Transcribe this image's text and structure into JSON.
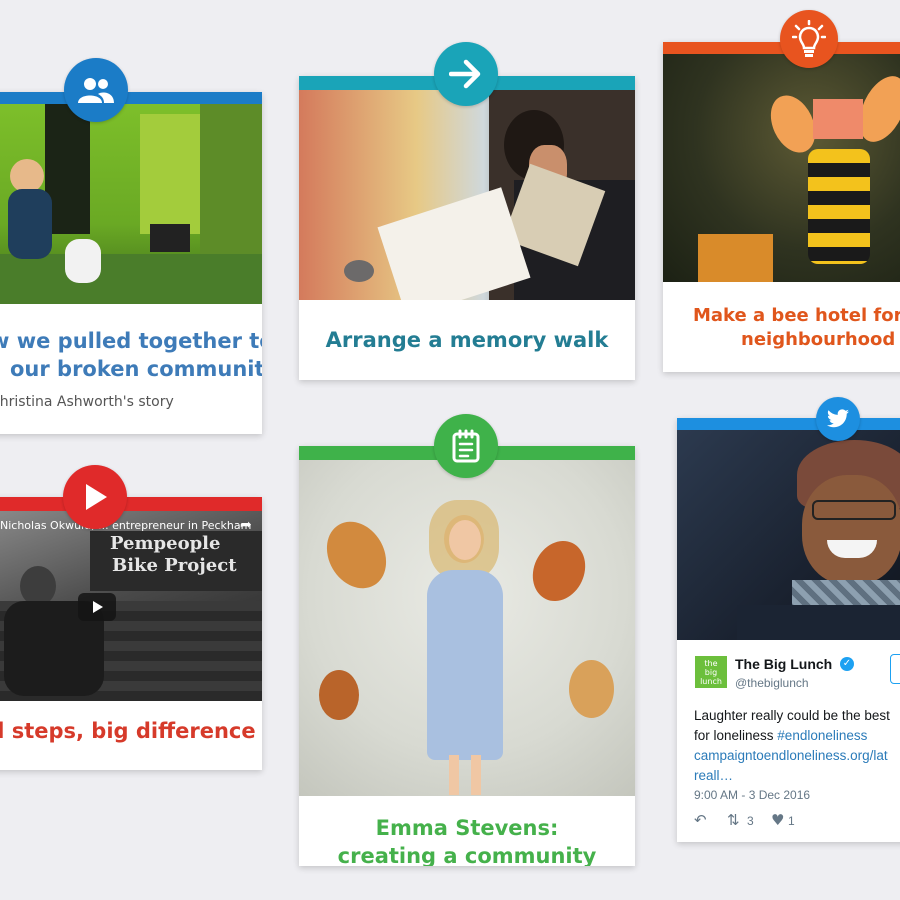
{
  "colors": {
    "blue": "#1b7cc7",
    "blue_text": "#3e7bb8",
    "teal": "#1aa4b8",
    "teal_text": "#237d93",
    "orange": "#e8541f",
    "orange_text": "#e0561c",
    "red": "#e02a2a",
    "red_text": "#d63a2a",
    "green": "#3fb24a",
    "green_text": "#45b14b",
    "twitter": "#1d8fe0"
  },
  "cards": {
    "community": {
      "icon": "people-icon",
      "title_line1": "w we pulled together to",
      "title_line2": "our broken community",
      "byline": "Christina Ashworth's story"
    },
    "memory_walk": {
      "icon": "arrow-right-icon",
      "title": "Arrange a memory walk"
    },
    "bee_hotel": {
      "icon": "lightbulb-icon",
      "title_line1": "Make a bee hotel for y",
      "title_line2": "neighbourhood"
    },
    "video": {
      "icon": "play-icon",
      "video_title": "Nicholas Okwulu, ... entrepreneur in Peckham",
      "sign_line1": "Pempeople",
      "sign_line2": "Bike Project",
      "title": "ll steps, big difference"
    },
    "emma": {
      "icon": "notepad-icon",
      "title_line1": "Emma Stevens:",
      "title_line2": "creating a community"
    },
    "tweet": {
      "icon": "twitter-bird-icon",
      "avatar_text": "the big lunch",
      "name": "The Big Lunch",
      "handle": "@thebiglunch",
      "text_line1": "Laughter really could be the best",
      "text_line2_plain": "for loneliness ",
      "hashtag": "#endloneliness",
      "link_line1": "campaigntoendloneliness.org/lat",
      "link_line2": "reall…",
      "timestamp": "9:00 AM - 3 Dec 2016",
      "retweets": "3",
      "likes": "1"
    }
  }
}
